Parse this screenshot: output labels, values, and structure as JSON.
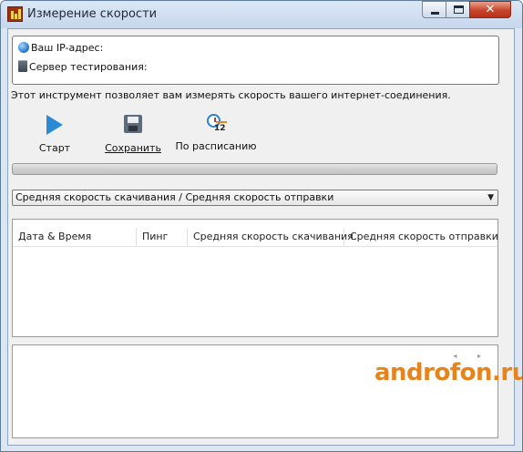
{
  "window": {
    "title": "Измерение скорости",
    "close_glyph": "✕"
  },
  "info": {
    "ip_label": "Ваш IP-адрес:",
    "server_label": "Сервер тестирования:"
  },
  "description": "Этот инструмент позволяет вам измерять скорость вашего интернет-соединения.",
  "toolbar": {
    "start_label": "Старт",
    "save_label": "Сохранить",
    "schedule_label": "По расписанию",
    "schedule_badge": "12"
  },
  "progress": {
    "value_percent": 0
  },
  "select": {
    "selected": "Средняя скорость скачивания / Средняя скорость отправки",
    "arrow": "▼"
  },
  "table": {
    "columns": [
      "Дата & Время",
      "Пинг",
      "Средняя скорость скачивания",
      "Средняя скорость отправки"
    ],
    "rows": []
  },
  "bottom_panel": {
    "nav_arrows": "◂ ▸"
  },
  "watermark": "androfon.ru",
  "colors": {
    "accent": "#2b8ad6",
    "watermark": "#e6831d",
    "close": "#c8452a"
  }
}
